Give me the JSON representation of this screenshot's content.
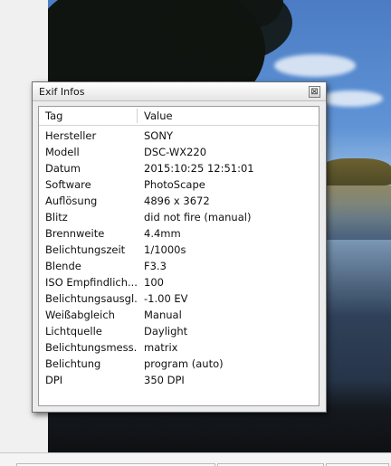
{
  "dialog": {
    "title": "Exif Infos",
    "close_label": "⊠"
  },
  "columns": {
    "tag": "Tag",
    "value": "Value"
  },
  "rows": [
    {
      "tag": "Hersteller",
      "value": "SONY"
    },
    {
      "tag": "Modell",
      "value": "DSC-WX220"
    },
    {
      "tag": "Datum",
      "value": "2015:10:25 12:51:01"
    },
    {
      "tag": "Software",
      "value": "PhotoScape"
    },
    {
      "tag": "Auflösung",
      "value": "4896 x 3672"
    },
    {
      "tag": "Blitz",
      "value": "did not fire (manual)"
    },
    {
      "tag": "Brennweite",
      "value": "4.4mm"
    },
    {
      "tag": "Belichtungszeit",
      "value": "1/1000s"
    },
    {
      "tag": "Blende",
      "value": "F3.3"
    },
    {
      "tag": "ISO Empfindlich...",
      "value": "100"
    },
    {
      "tag": "Belichtungsausgl...",
      "value": "-1.00 EV"
    },
    {
      "tag": "Weißabgleich",
      "value": "Manual"
    },
    {
      "tag": "Lichtquelle",
      "value": "Daylight"
    },
    {
      "tag": "Belichtungsmess...",
      "value": "matrix"
    },
    {
      "tag": "Belichtung",
      "value": "program (auto)"
    },
    {
      "tag": "DPI",
      "value": "350 DPI"
    }
  ]
}
